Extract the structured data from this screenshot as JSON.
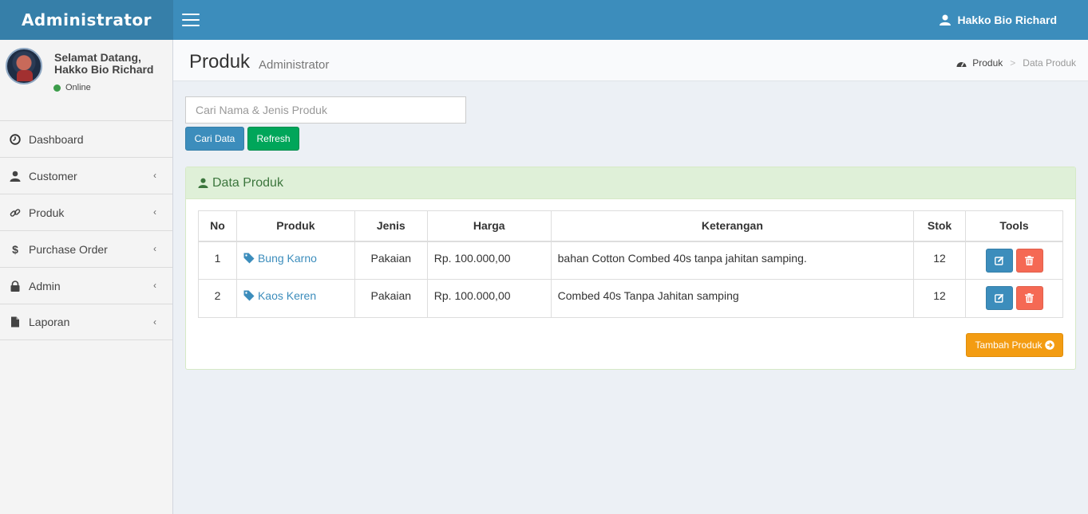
{
  "app": {
    "logo": "Administrator"
  },
  "topbar": {
    "user_name": "Hakko Bio Richard"
  },
  "sidebar": {
    "welcome_line1": "Selamat Datang,",
    "welcome_line2": "Hakko Bio Richard",
    "status": "Online",
    "items": [
      {
        "label": "Dashboard",
        "icon": "dashboard-icon"
      },
      {
        "label": "Customer",
        "icon": "user-icon"
      },
      {
        "label": "Produk",
        "icon": "link-icon"
      },
      {
        "label": "Purchase Order",
        "icon": "dollar-icon"
      },
      {
        "label": "Admin",
        "icon": "lock-icon"
      },
      {
        "label": "Laporan",
        "icon": "file-icon"
      }
    ]
  },
  "header": {
    "title": "Produk",
    "subtitle": "Administrator",
    "breadcrumb": [
      "Produk",
      "Data Produk"
    ]
  },
  "search": {
    "placeholder": "Cari Nama & Jenis Produk",
    "value": "",
    "search_label": "Cari Data",
    "refresh_label": "Refresh"
  },
  "box": {
    "title": "Data Produk",
    "columns": [
      "No",
      "Produk",
      "Jenis",
      "Harga",
      "Keterangan",
      "Stok",
      "Tools"
    ],
    "rows": [
      {
        "no": "1",
        "produk": "Bung Karno",
        "jenis": "Pakaian",
        "harga": "Rp. 100.000,00",
        "keterangan": "bahan Cotton Combed 40s tanpa jahitan samping.",
        "stok": "12"
      },
      {
        "no": "2",
        "produk": "Kaos Keren",
        "jenis": "Pakaian",
        "harga": "Rp. 100.000,00",
        "keterangan": "Combed 40s Tanpa Jahitan samping",
        "stok": "12"
      }
    ],
    "add_label": "Tambah Produk"
  },
  "colors": {
    "primary": "#3c8dbc",
    "success": "#00a65a",
    "danger": "#f56954",
    "warning": "#f39c12"
  }
}
